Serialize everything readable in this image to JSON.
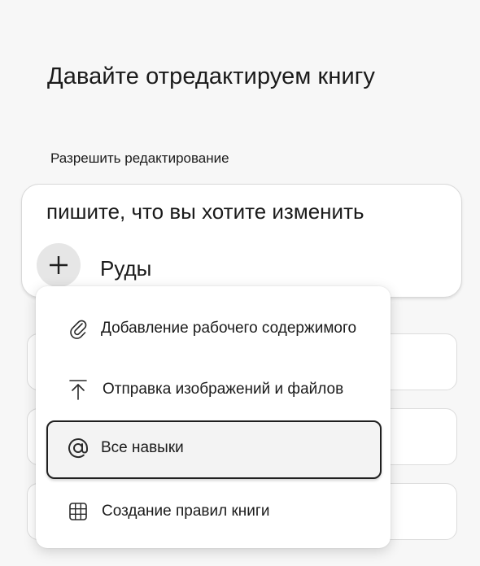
{
  "page": {
    "title": "Давайте отредактируем книгу"
  },
  "section": {
    "label": "Разрешить редактирование"
  },
  "prompt": {
    "text": "пишите, что вы хотите изменить",
    "mention": "Руды",
    "add_icon": "plus-icon"
  },
  "menu": {
    "items": [
      {
        "label": "Добавление рабочего содержимого",
        "icon": "paperclip-icon"
      },
      {
        "label": "Отправка изображений и файлов",
        "icon": "upload-icon"
      },
      {
        "label": "Все навыки",
        "icon": "at-sign-icon",
        "selected": true
      },
      {
        "label": "Создание правил книги",
        "icon": "table-grid-icon"
      }
    ]
  }
}
